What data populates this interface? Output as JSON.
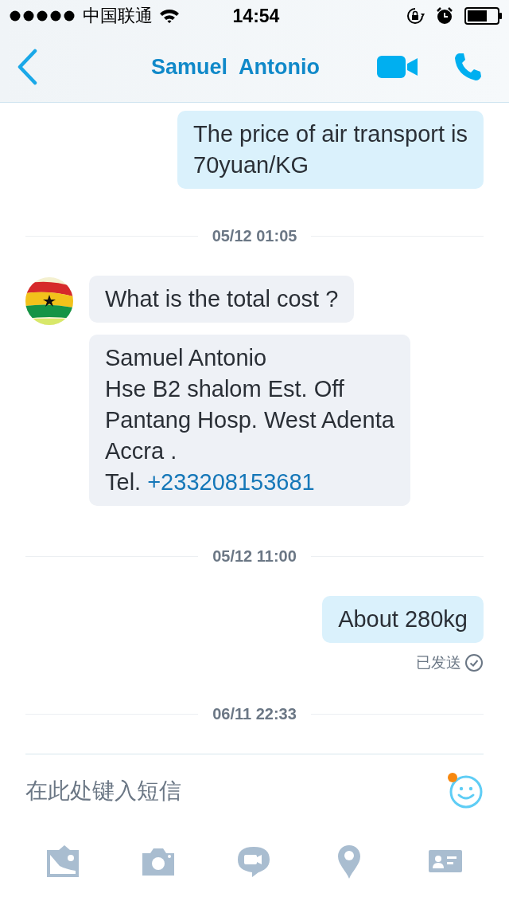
{
  "status_bar": {
    "carrier": "中国联通",
    "time": "14:54"
  },
  "header": {
    "title": "Samuel  Antonio"
  },
  "messages": [
    {
      "kind": "outgoing",
      "text": "The price of air transport is\n70yuan/KG"
    },
    {
      "kind": "date",
      "text": "05/12 01:05"
    },
    {
      "kind": "incoming",
      "text": "What is the total cost ?"
    },
    {
      "kind": "incoming",
      "text": "Samuel Antonio\nHse B2 shalom Est. Off\nPantang Hosp. West Adenta\nAccra .\nTel. ",
      "link": "+233208153681"
    },
    {
      "kind": "date",
      "text": "05/12 11:00"
    },
    {
      "kind": "outgoing",
      "text": "About 280kg",
      "status": "已发送"
    },
    {
      "kind": "date",
      "text": "06/11 22:33"
    }
  ],
  "composer": {
    "placeholder": "在此处键入短信"
  }
}
